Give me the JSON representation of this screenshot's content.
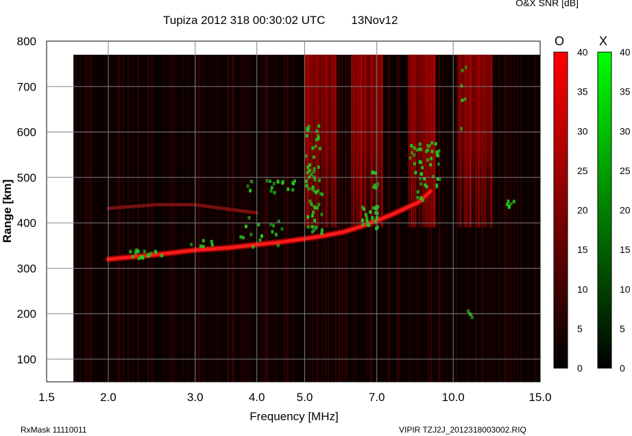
{
  "header": {
    "title": "Tupiza 2012 318 00:30:02 UTC        13Nov12",
    "snr_label": "O&X SNR [dB]"
  },
  "footer": {
    "left": "RxMask 11110011",
    "right": "VIPIR  TZJ2J_2012318003002.RIQ"
  },
  "colors": {
    "o_mode": "#ff1a1a",
    "x_mode": "#22cc22",
    "background": "#0a0000",
    "grid": "#808080"
  },
  "chart_data": {
    "type": "heatmap",
    "title": "Tupiza 2012 318 00:30:02 UTC        13Nov12",
    "xlabel": "Frequency [MHz]",
    "ylabel": "Range [km]",
    "x_scale": "log",
    "xlim": [
      1.5,
      15.0
    ],
    "ylim": [
      50,
      800
    ],
    "x_ticks": [
      1.5,
      2.0,
      3.0,
      4.0,
      5.0,
      7.0,
      10.0,
      15.0
    ],
    "x_tick_labels": [
      "1.5",
      "2.0",
      "3.0",
      "4.0",
      "5.0",
      "7.0",
      "10.0",
      "15.0"
    ],
    "y_ticks": [
      100,
      200,
      300,
      400,
      500,
      600,
      700,
      800
    ],
    "y_tick_labels": [
      "100",
      "200",
      "300",
      "400",
      "500",
      "600",
      "700",
      "800"
    ],
    "colorbars": [
      {
        "name": "O",
        "range": [
          0,
          40
        ],
        "ticks": [
          0,
          5,
          10,
          15,
          20,
          25,
          30,
          35,
          40
        ],
        "color": "#ff1a1a"
      },
      {
        "name": "X",
        "range": [
          0,
          40
        ],
        "ticks": [
          0,
          5,
          10,
          15,
          20,
          25,
          30,
          35,
          40
        ],
        "color": "#22cc22"
      }
    ],
    "data_frequency_range_mhz": [
      1.7,
      15.0
    ],
    "data_range_max_km": 770,
    "o_trace_1": {
      "frequency_mhz": [
        2.0,
        2.5,
        3.0,
        3.5,
        4.0,
        4.5,
        5.0,
        5.5,
        6.0,
        6.5,
        7.0,
        7.5,
        8.0,
        8.5,
        9.0
      ],
      "range_km": [
        320,
        330,
        340,
        345,
        352,
        358,
        365,
        372,
        380,
        392,
        405,
        418,
        432,
        445,
        470
      ]
    },
    "o_trace_2": {
      "frequency_mhz": [
        2.0,
        2.5,
        3.0,
        3.5,
        4.0
      ],
      "range_km": [
        432,
        440,
        440,
        430,
        422
      ]
    },
    "o_bands_mhz": [
      [
        5.0,
        5.8
      ],
      [
        6.2,
        7.2
      ],
      [
        8.1,
        9.2
      ],
      [
        10.2,
        12.0
      ]
    ]
  }
}
